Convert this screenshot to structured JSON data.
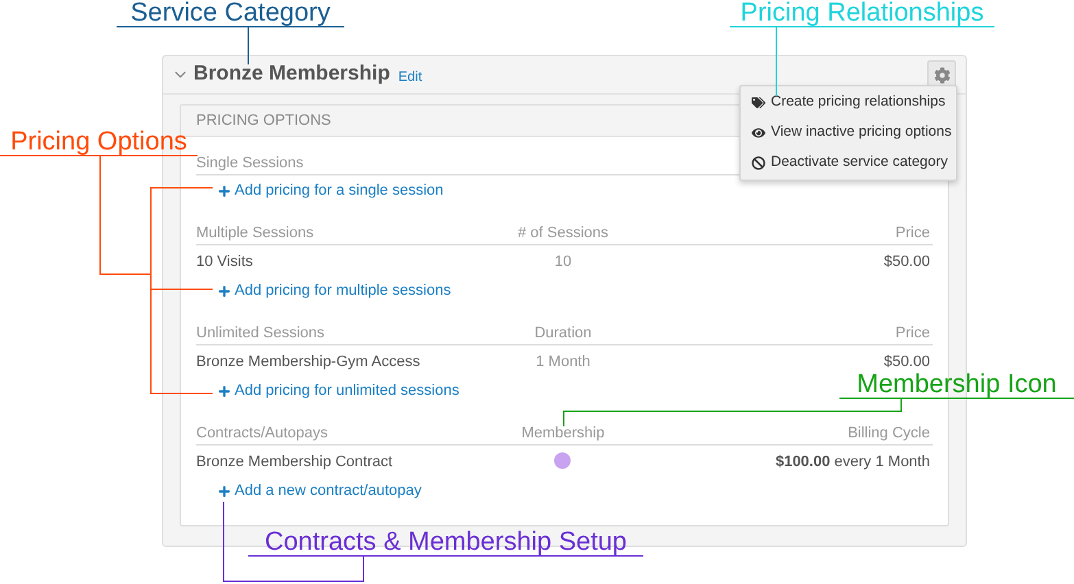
{
  "category": {
    "title": "Bronze Membership",
    "edit_link": "Edit",
    "expanded": true
  },
  "menu": [
    {
      "kind": "tags",
      "label": "Create pricing relationships"
    },
    {
      "kind": "eye",
      "label": "View inactive pricing options"
    },
    {
      "kind": "ban",
      "label": "Deactivate service category"
    }
  ],
  "pricing_options": {
    "heading": "PRICING OPTIONS",
    "sections": [
      {
        "columns": [
          "Single Sessions"
        ],
        "add_link": "Add pricing for a single session"
      },
      {
        "columns": [
          "Multiple Sessions",
          "# of Sessions",
          "Price"
        ],
        "rows": [
          [
            {
              "kind": "text",
              "text": "10 Visits"
            },
            {
              "kind": "text",
              "text": "10"
            },
            {
              "kind": "text",
              "text": "$50.00"
            }
          ]
        ],
        "add_link": "Add pricing for multiple sessions"
      },
      {
        "columns": [
          "Unlimited Sessions",
          "Duration",
          "Price"
        ],
        "rows": [
          [
            {
              "kind": "text",
              "text": "Bronze Membership-Gym Access"
            },
            {
              "kind": "text",
              "text": "1 Month"
            },
            {
              "kind": "text",
              "text": "$50.00"
            }
          ]
        ],
        "add_link": "Add pricing for unlimited sessions"
      },
      {
        "columns": [
          "Contracts/Autopays",
          "Membership",
          "Billing Cycle"
        ],
        "rows": [
          [
            {
              "kind": "text",
              "text": "Bronze Membership Contract"
            },
            {
              "kind": "dot",
              "color": "#c9a3f0"
            },
            {
              "kind": "text",
              "text": "**$100.00** every 1 Month"
            }
          ]
        ],
        "add_link": "Add a new contract/autopay"
      }
    ]
  },
  "annotations": [
    {
      "label": "Service Category",
      "color": "#1b5f93"
    },
    {
      "label": "Pricing Relationships",
      "color": "#1fd4dc"
    },
    {
      "label": "Pricing Options",
      "color": "#ff4b0a"
    },
    {
      "label": "Membership Icon",
      "color": "#17a317"
    },
    {
      "label": "Contracts & Membership Setup",
      "color": "#6a2fd4"
    }
  ]
}
